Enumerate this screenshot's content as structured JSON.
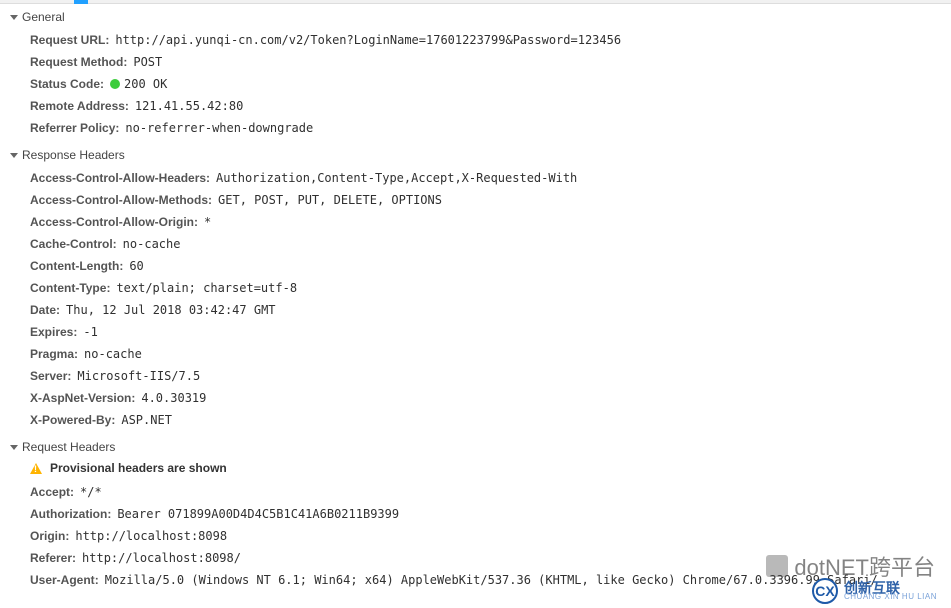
{
  "sections": {
    "general": {
      "title": "General",
      "items": {
        "request_url": {
          "label": "Request URL",
          "value": "http://api.yunqi-cn.com/v2/Token?LoginName=17601223799&Password=123456"
        },
        "request_method": {
          "label": "Request Method",
          "value": "POST"
        },
        "status_code": {
          "label": "Status Code",
          "value": "200 OK"
        },
        "remote_address": {
          "label": "Remote Address",
          "value": "121.41.55.42:80"
        },
        "referrer_policy": {
          "label": "Referrer Policy",
          "value": "no-referrer-when-downgrade"
        }
      }
    },
    "response_headers": {
      "title": "Response Headers",
      "items": {
        "ac_allow_headers": {
          "label": "Access-Control-Allow-Headers",
          "value": "Authorization,Content-Type,Accept,X-Requested-With"
        },
        "ac_allow_methods": {
          "label": "Access-Control-Allow-Methods",
          "value": "GET, POST, PUT, DELETE, OPTIONS"
        },
        "ac_allow_origin": {
          "label": "Access-Control-Allow-Origin",
          "value": "*"
        },
        "cache_control": {
          "label": "Cache-Control",
          "value": "no-cache"
        },
        "content_length": {
          "label": "Content-Length",
          "value": "60"
        },
        "content_type": {
          "label": "Content-Type",
          "value": "text/plain; charset=utf-8"
        },
        "date": {
          "label": "Date",
          "value": "Thu, 12 Jul 2018 03:42:47 GMT"
        },
        "expires": {
          "label": "Expires",
          "value": "-1"
        },
        "pragma": {
          "label": "Pragma",
          "value": "no-cache"
        },
        "server": {
          "label": "Server",
          "value": "Microsoft-IIS/7.5"
        },
        "x_aspnet_version": {
          "label": "X-AspNet-Version",
          "value": "4.0.30319"
        },
        "x_powered_by": {
          "label": "X-Powered-By",
          "value": "ASP.NET"
        }
      }
    },
    "request_headers": {
      "title": "Request Headers",
      "warning": "Provisional headers are shown",
      "items": {
        "accept": {
          "label": "Accept",
          "value": "*/*"
        },
        "authorization": {
          "label": "Authorization",
          "value": "Bearer 071899A00D4D4C5B1C41A6B0211B9399"
        },
        "origin": {
          "label": "Origin",
          "value": "http://localhost:8098"
        },
        "referer": {
          "label": "Referer",
          "value": "http://localhost:8098/"
        },
        "user_agent": {
          "label": "User-Agent",
          "value": "Mozilla/5.0 (Windows NT 6.1; Win64; x64) AppleWebKit/537.36 (KHTML, like Gecko) Chrome/67.0.3396.99 Safari/"
        }
      }
    }
  },
  "status_color": "#3ccc3c",
  "watermark": "dotNET跨平台",
  "logo": {
    "main": "创新互联",
    "sub": "CHUANG XIN HU LIAN",
    "badge": "CX"
  }
}
